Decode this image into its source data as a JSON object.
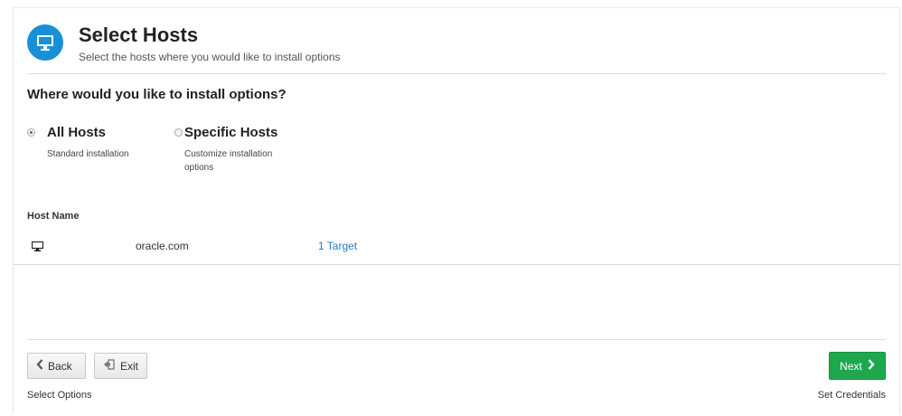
{
  "header": {
    "icon": "monitor-icon",
    "title": "Select Hosts",
    "subtitle": "Select the hosts where you would like to install options",
    "accent_color": "#1a8fd6"
  },
  "question": "Where would you like to install options?",
  "options": [
    {
      "label": "All Hosts",
      "description": "Standard installation",
      "selected": true
    },
    {
      "label": "Specific Hosts",
      "description_line1": "Customize installation",
      "description_line2": "options",
      "selected": false
    }
  ],
  "table": {
    "column_header": "Host Name",
    "rows": [
      {
        "icon": "monitor-icon",
        "host": "oracle.com",
        "targets": "1 Target"
      }
    ]
  },
  "footer": {
    "back_label": "Back",
    "exit_label": "Exit",
    "next_label": "Next",
    "prev_step": "Select Options",
    "next_step": "Set Credentials",
    "next_color": "#1ea84e"
  }
}
